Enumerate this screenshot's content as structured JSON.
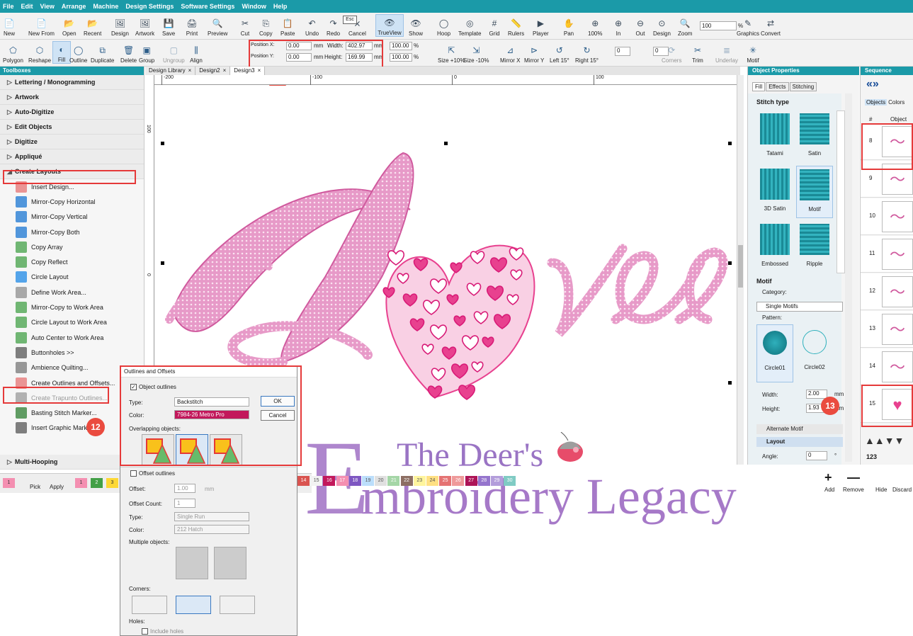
{
  "menu": [
    "File",
    "Edit",
    "View",
    "Arrange",
    "Machine",
    "Design Settings",
    "Software Settings",
    "Window",
    "Help"
  ],
  "toolbar1": {
    "buttons": [
      "New",
      "New From",
      "Open",
      "Recent",
      "Design",
      "Artwork",
      "Save",
      "Print",
      "Preview",
      "Cut",
      "Copy",
      "Paste",
      "Undo",
      "Redo",
      "Cancel",
      "TrueView",
      "Show",
      "Hoop",
      "Template",
      "Grid",
      "Rulers",
      "Player",
      "Pan",
      "100%",
      "In",
      "Out",
      "Design",
      "Zoom",
      "Graphics",
      "Convert"
    ],
    "esc_key": "Esc",
    "zoom_value": "100",
    "zoom_unit": "%"
  },
  "toolbar2": {
    "buttons": [
      "Polygon",
      "Reshape",
      "Fill",
      "Outline",
      "Duplicate",
      "Delete",
      "Group",
      "Ungroup",
      "Align",
      "Size +10%",
      "Size -10%",
      "Mirror X",
      "Mirror Y",
      "Left 15°",
      "Right 15°",
      "Corners",
      "Trim",
      "Underlay",
      "Motif"
    ],
    "position_x_label": "Position X:",
    "position_x": "0.00",
    "position_y_label": "Position Y:",
    "position_y": "0.00",
    "unit_mm": "mm",
    "width_label": "Width:",
    "width": "402.97",
    "height_label": "Height:",
    "height": "169.99",
    "scale_w": "100.00",
    "scale_h": "100.00",
    "percent": "%",
    "rotate_value": "0",
    "slant_value": "0",
    "rot15": "15°"
  },
  "toolbox": {
    "title": "Toolboxes",
    "sections_top": [
      "Lettering / Monogramming",
      "Artwork",
      "Auto-Digitize",
      "Edit Objects",
      "Digitize",
      "Appliqué",
      "Create Layouts"
    ],
    "items": [
      "Insert Design...",
      "Mirror-Copy Horizontal",
      "Mirror-Copy Vertical",
      "Mirror-Copy Both",
      "Copy Array",
      "Copy Reflect",
      "Circle Layout",
      "Define Work Area...",
      "Mirror-Copy to Work Area",
      "Circle Layout to Work Area",
      "Auto Center to Work Area",
      "Buttonholes >>",
      "Ambience Quilting...",
      "Create Outlines and Offsets...",
      "Create Trapunto Outlines...",
      "Basting Stitch Marker...",
      "Insert Graphic Marker..."
    ],
    "section_bottom": "Multi-Hooping"
  },
  "tabs": [
    "Design Library",
    "Design2",
    "Design3"
  ],
  "ruler": {
    "h": [
      "-200",
      "-100",
      "0",
      "100"
    ],
    "v": [
      "100",
      "0"
    ]
  },
  "object_properties": {
    "title": "Object Properties",
    "tabs": [
      "Fill",
      "Effects",
      "Stitching"
    ],
    "stitch_type_label": "Stitch type",
    "stitch_types": [
      "Tatami",
      "Satin",
      "3D Satin",
      "Motif",
      "Embossed",
      "Ripple"
    ],
    "motif_label": "Motif",
    "category_label": "Category:",
    "category_value": "Single Motifs",
    "pattern_label": "Pattern:",
    "patterns": [
      "Circle01",
      "Circle02"
    ],
    "width_label": "Width:",
    "width_value": "2.00",
    "height_label": "Height:",
    "height_value": "1.93",
    "unit": "mm",
    "alt_motif": "Alternate Motif",
    "layout": "Layout",
    "angle_label": "Angle:",
    "angle_value": "0",
    "deg": "°"
  },
  "sequence": {
    "title": "Sequence",
    "tabs": [
      "Objects",
      "Colors"
    ],
    "col_num": "#",
    "col_obj": "Object",
    "rows": [
      "8",
      "9",
      "10",
      "11",
      "12",
      "13",
      "14",
      "15"
    ],
    "buttons": [
      "Add",
      "Remove",
      "Hide",
      "Discard"
    ],
    "num_label": "123"
  },
  "palette": {
    "left": [
      "1",
      "2",
      "3"
    ],
    "pick": "Pick",
    "apply": "Apply",
    "numbers": [
      "14",
      "15",
      "16",
      "17",
      "18",
      "19",
      "20",
      "21",
      "22",
      "23",
      "24",
      "25",
      "26",
      "27",
      "28",
      "29",
      "30"
    ],
    "colors": [
      "#d9534f",
      "#f2f2f2",
      "#c2185b",
      "#f48fb1",
      "#7e57c2",
      "#bbdefb",
      "#e0e0e0",
      "#a5d6a7",
      "#8d6e63",
      "#fff59d",
      "#ffe082",
      "#e57373",
      "#ef9a9a",
      "#ad1457",
      "#9575cd",
      "#b39ddb",
      "#80cbc4"
    ]
  },
  "dialog": {
    "title": "Outlines and Offsets",
    "object_outlines": "Object outlines",
    "type_label": "Type:",
    "type_value": "Backstitch",
    "color_label": "Color:",
    "color_value": "7984-26 Metro Pro",
    "ok": "OK",
    "cancel": "Cancel",
    "overlapping": "Overlapping objects:",
    "offset_outlines": "Offset outlines",
    "offset_label": "Offset:",
    "offset_value": "1.00",
    "offset_unit": "mm",
    "offset_count_label": "Offset Count:",
    "offset_count_value": "1",
    "type2_label": "Type:",
    "type2_value": "Single Run",
    "color2_label": "Color:",
    "color2_value": "212 Hatch",
    "multiple": "Multiple objects:",
    "corners": "Corners:",
    "holes": "Holes:",
    "include_holes": "Include holes"
  },
  "callouts": [
    "14",
    "13",
    "12"
  ],
  "watermark": {
    "line1": "The Deer's",
    "line2": "Embroidery Legacy"
  },
  "colors": {
    "accent": "#1b9aa8",
    "highlight": "#e53a3a",
    "love": "#e070b0",
    "heart": "#e8418f"
  }
}
